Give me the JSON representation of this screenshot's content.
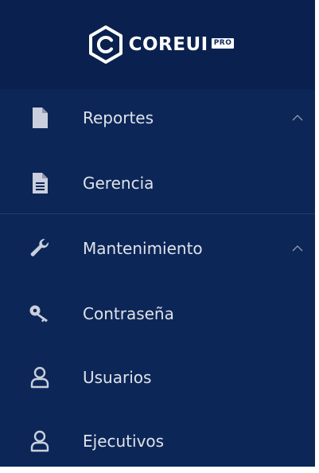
{
  "brand": {
    "name": "COREUI",
    "badge": "PRO",
    "logo_icon": "coreui-hexagon-icon"
  },
  "nav": [
    {
      "label": "Reportes",
      "icon": "file-icon",
      "expanded": true
    },
    {
      "label": "Gerencia",
      "icon": "file-text-icon"
    },
    {
      "label": "Mantenimiento",
      "icon": "wrench-icon",
      "expanded": true
    },
    {
      "label": "Contraseña",
      "icon": "key-icon"
    },
    {
      "label": "Usuarios",
      "icon": "user-icon"
    },
    {
      "label": "Ejecutivos",
      "icon": "user-icon"
    }
  ],
  "colors": {
    "sidebar_bg": "#0c2657",
    "brand_bg": "#0a2150",
    "text": "#ffffff",
    "icon": "#c9cfdc"
  }
}
